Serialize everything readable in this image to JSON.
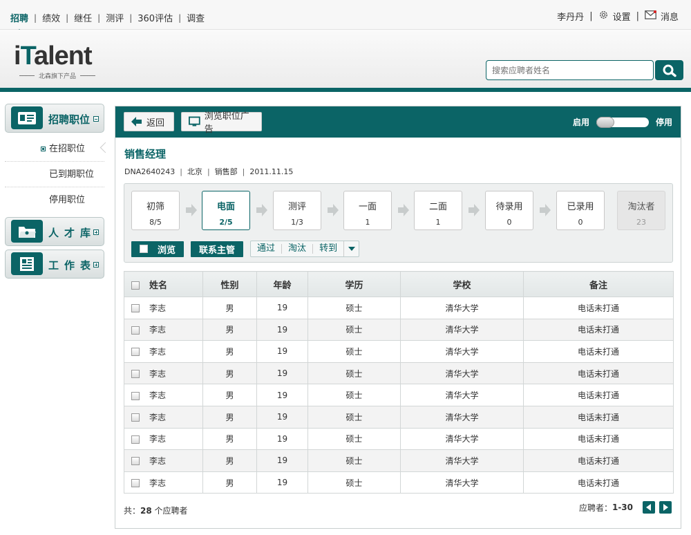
{
  "topnav": {
    "items": [
      {
        "label": "招聘",
        "active": true
      },
      {
        "label": "绩效"
      },
      {
        "label": "继任"
      },
      {
        "label": "测评"
      },
      {
        "label": "360评估"
      },
      {
        "label": "调查"
      }
    ],
    "user": "李丹丹",
    "settings": "设置",
    "messages": "消息"
  },
  "header": {
    "brand_i": "i",
    "brand_t": "T",
    "brand_rest": "alent",
    "tagline": "北森旗下产品",
    "search_placeholder": "搜索应聘者姓名"
  },
  "sidebar": {
    "recruit": "招聘职位",
    "sub": [
      "在招职位",
      "已到期职位",
      "停用职位"
    ],
    "talent": "人才库",
    "worksheet": "工作表"
  },
  "main": {
    "back": "返回",
    "browse_ad": "浏览职位广告",
    "enable": "启用",
    "disable": "停用",
    "job_title": "销售经理",
    "meta": [
      "DNA2640243",
      "北京",
      "销售部",
      "2011.11.15"
    ],
    "stages": [
      {
        "name": "初筛",
        "count": "8/5"
      },
      {
        "name": "电面",
        "count": "2/5",
        "active": true
      },
      {
        "name": "测评",
        "count": "1/3"
      },
      {
        "name": "一面",
        "count": "1"
      },
      {
        "name": "二面",
        "count": "1"
      },
      {
        "name": "待录用",
        "count": "0"
      },
      {
        "name": "已录用",
        "count": "0"
      },
      {
        "name": "淘汰者",
        "count": "23",
        "dim": true
      }
    ],
    "toolbar": {
      "browse": "浏览",
      "contact": "联系主管",
      "pass": "通过",
      "eliminate": "淘汰",
      "transfer": "转到"
    },
    "table": {
      "headers": [
        "姓名",
        "性别",
        "年龄",
        "学历",
        "学校",
        "备注"
      ],
      "rows": [
        [
          "李志",
          "男",
          "19",
          "硕士",
          "清华大学",
          "电话未打通"
        ],
        [
          "李志",
          "男",
          "19",
          "硕士",
          "清华大学",
          "电话未打通"
        ],
        [
          "李志",
          "男",
          "19",
          "硕士",
          "清华大学",
          "电话未打通"
        ],
        [
          "李志",
          "男",
          "19",
          "硕士",
          "清华大学",
          "电话未打通"
        ],
        [
          "李志",
          "男",
          "19",
          "硕士",
          "清华大学",
          "电话未打通"
        ],
        [
          "李志",
          "男",
          "19",
          "硕士",
          "清华大学",
          "电话未打通"
        ],
        [
          "李志",
          "男",
          "19",
          "硕士",
          "清华大学",
          "电话未打通"
        ],
        [
          "李志",
          "男",
          "19",
          "硕士",
          "清华大学",
          "电话未打通"
        ],
        [
          "李志",
          "男",
          "19",
          "硕士",
          "清华大学",
          "电话未打通"
        ]
      ]
    },
    "footer": {
      "total_prefix": "共：",
      "total": "28",
      "total_suffix": " 个应聘者",
      "range_label": "应聘者：",
      "range": "1-30"
    }
  },
  "colors": {
    "accent": "#0b6466"
  }
}
